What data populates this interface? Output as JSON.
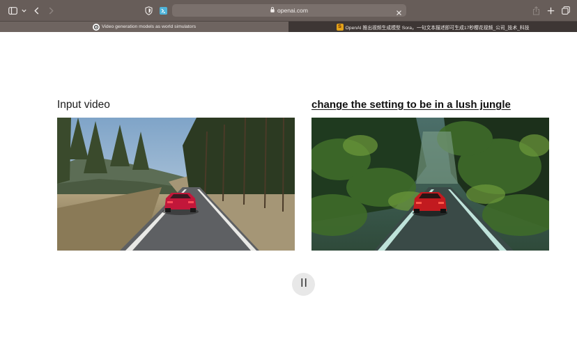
{
  "browser": {
    "address": "openai.com",
    "tabs": [
      {
        "label": "Video generation models as world simulators",
        "active": true,
        "favicon": "openai-logo-icon"
      },
      {
        "label": "OpenAI 推出视频生成模型 Sora，一句文本描述即可生成17秒樱花视频_公司_技术_科技",
        "active": false,
        "favicon": "s-logo-icon"
      }
    ]
  },
  "page": {
    "input_label": "Input video",
    "output_label": "change the setting to be in a lush jungle",
    "player": {
      "state": "playing",
      "control_icon": "pause-icon"
    }
  },
  "colors": {
    "toolbar_bg": "#675d59",
    "page_bg": "#ffffff",
    "pause_button_bg": "#e8e8e8"
  }
}
